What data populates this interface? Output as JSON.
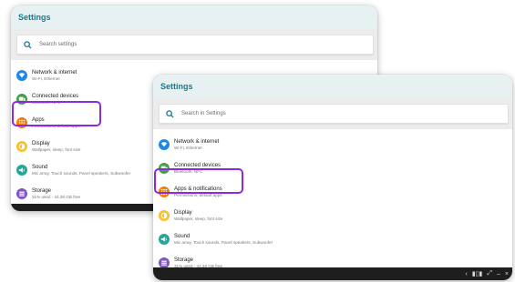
{
  "colors": {
    "accent": "#147a8c",
    "header_bg": "#e7f1f1",
    "selection": "#8a2be2"
  },
  "screens": [
    {
      "header": {
        "title": "Settings"
      },
      "search": {
        "placeholder": "Search settings"
      },
      "items": [
        {
          "icon": "wifi-icon",
          "color": "#1e88e5",
          "title": "Network & internet",
          "subtitle": "Wi-Fi, Ethernet"
        },
        {
          "icon": "devices-icon",
          "color": "#43a047",
          "title": "Connected devices",
          "subtitle": "Bluetooth, NFC"
        },
        {
          "icon": "apps-icon",
          "color": "#f57c00",
          "title": "Apps",
          "subtitle": "Permissions, default apps",
          "selected": true
        },
        {
          "icon": "brightness-icon",
          "color": "#fbc02d",
          "title": "Display",
          "subtitle": "Wallpaper, sleep, font size"
        },
        {
          "icon": "volume-icon",
          "color": "#26a69a",
          "title": "Sound",
          "subtitle": "Mic array, Touch sounds, Panel speakers, Subwoofer"
        },
        {
          "icon": "storage-icon",
          "color": "#7e57c2",
          "title": "Storage",
          "subtitle": "31% used - 44.36 GB free"
        }
      ]
    },
    {
      "header": {
        "title": "Settings"
      },
      "search": {
        "placeholder": "Search in Settings"
      },
      "items": [
        {
          "icon": "wifi-icon",
          "color": "#1e88e5",
          "title": "Network & internet",
          "subtitle": "Wi-Fi, Ethernet"
        },
        {
          "icon": "devices-icon",
          "color": "#43a047",
          "title": "Connected devices",
          "subtitle": "Bluetooth, NFC"
        },
        {
          "icon": "apps-icon",
          "color": "#f57c00",
          "title": "Apps & notifications",
          "subtitle": "Permissions, default apps",
          "selected": true
        },
        {
          "icon": "brightness-icon",
          "color": "#fbc02d",
          "title": "Display",
          "subtitle": "Wallpaper, sleep, font size"
        },
        {
          "icon": "volume-icon",
          "color": "#26a69a",
          "title": "Sound",
          "subtitle": "Mic array, Touch sounds, Panel speakers, Subwoofer"
        },
        {
          "icon": "storage-icon",
          "color": "#7e57c2",
          "title": "Storage",
          "subtitle": "31% used - 44.36 GB free"
        }
      ],
      "navbar": {
        "back": "‹",
        "recents": "▮▯▮",
        "fullscreen": "⤢",
        "minimize": "–",
        "close": "×"
      }
    }
  ]
}
